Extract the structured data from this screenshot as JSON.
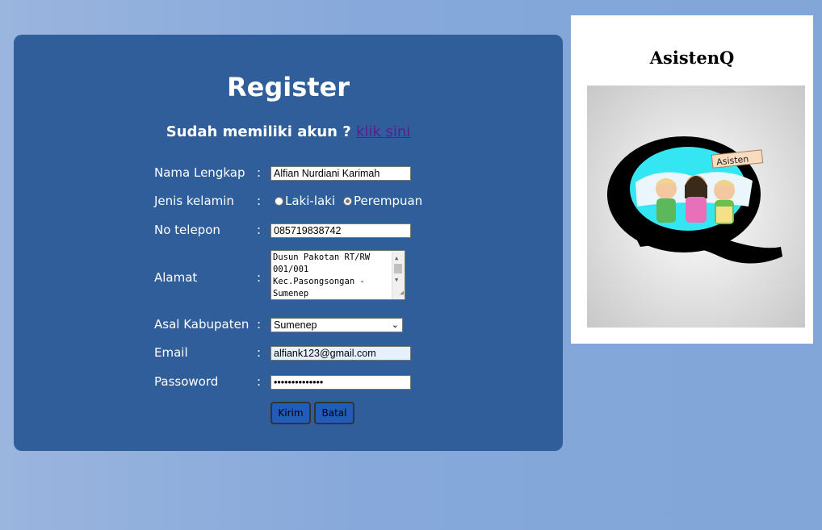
{
  "register": {
    "title": "Register",
    "login_prompt": "Sudah memiliki akun ?",
    "login_link": "klik sini"
  },
  "form": {
    "colon": ":",
    "name_label": "Nama Lengkap",
    "name_value": "Alfian Nurdiani Karimah",
    "gender_label": "Jenis kelamin",
    "gender_options": [
      "Laki-laki",
      "Perempuan"
    ],
    "gender_selected": "Perempuan",
    "phone_label": "No telepon",
    "phone_value": "085719838742",
    "address_label": "Alamat",
    "address_lines": [
      "Dusun Pakotan RT/RW",
      "001/001",
      "Kec.Pasongsongan -",
      "Sumenep"
    ],
    "district_label": "Asal Kabupaten",
    "district_value": "Sumenep",
    "email_label": "Email",
    "email_value": "alfiank123@gmail.com",
    "password_label": "Passoword",
    "password_value": "••••••••••••••",
    "submit_label": "Kirim",
    "cancel_label": "Batal"
  },
  "sidebar": {
    "title": "AsistenQ",
    "logo_banner": "Asisten"
  },
  "colors": {
    "page_background": "#86a8da",
    "panel": "#2f5e9b",
    "link": "#5b1e8c",
    "button": "#1f5db8"
  }
}
